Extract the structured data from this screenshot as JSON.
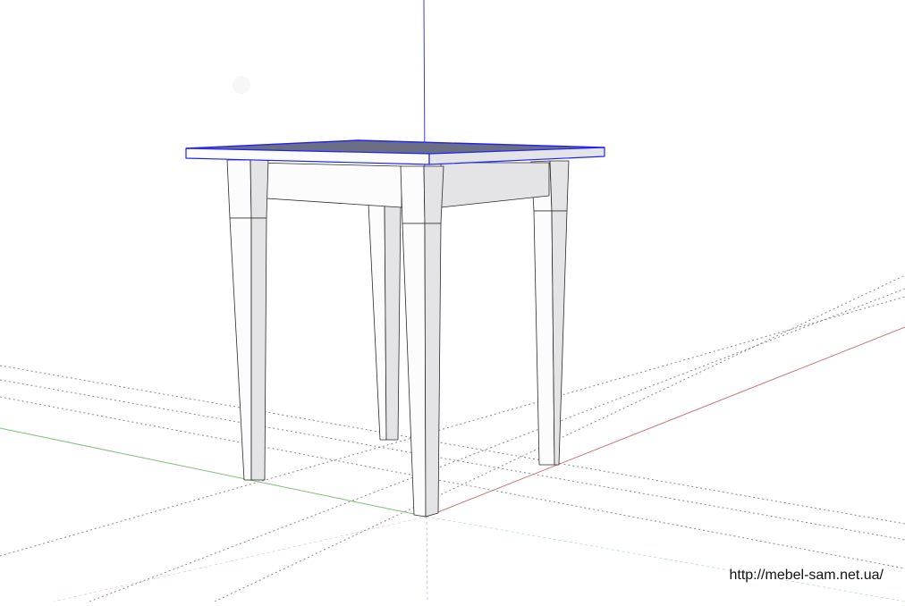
{
  "scene": {
    "model": "table",
    "watermark": "http://mebel-sam.net.ua/"
  },
  "colors": {
    "background": "#ffffff",
    "blue_axis": "#3b3bd9",
    "red_axis": "#c97a7a",
    "green_axis": "#7fbf7f",
    "guides": "#8a8a8a",
    "edge": "#2a2a2a",
    "front_face": "#fcfcfc",
    "side_face": "#e4e4e6",
    "top_face": "#6b6f84",
    "selection": "#2020ff"
  },
  "icons": {
    "guide_point": "faint-circle-icon"
  }
}
